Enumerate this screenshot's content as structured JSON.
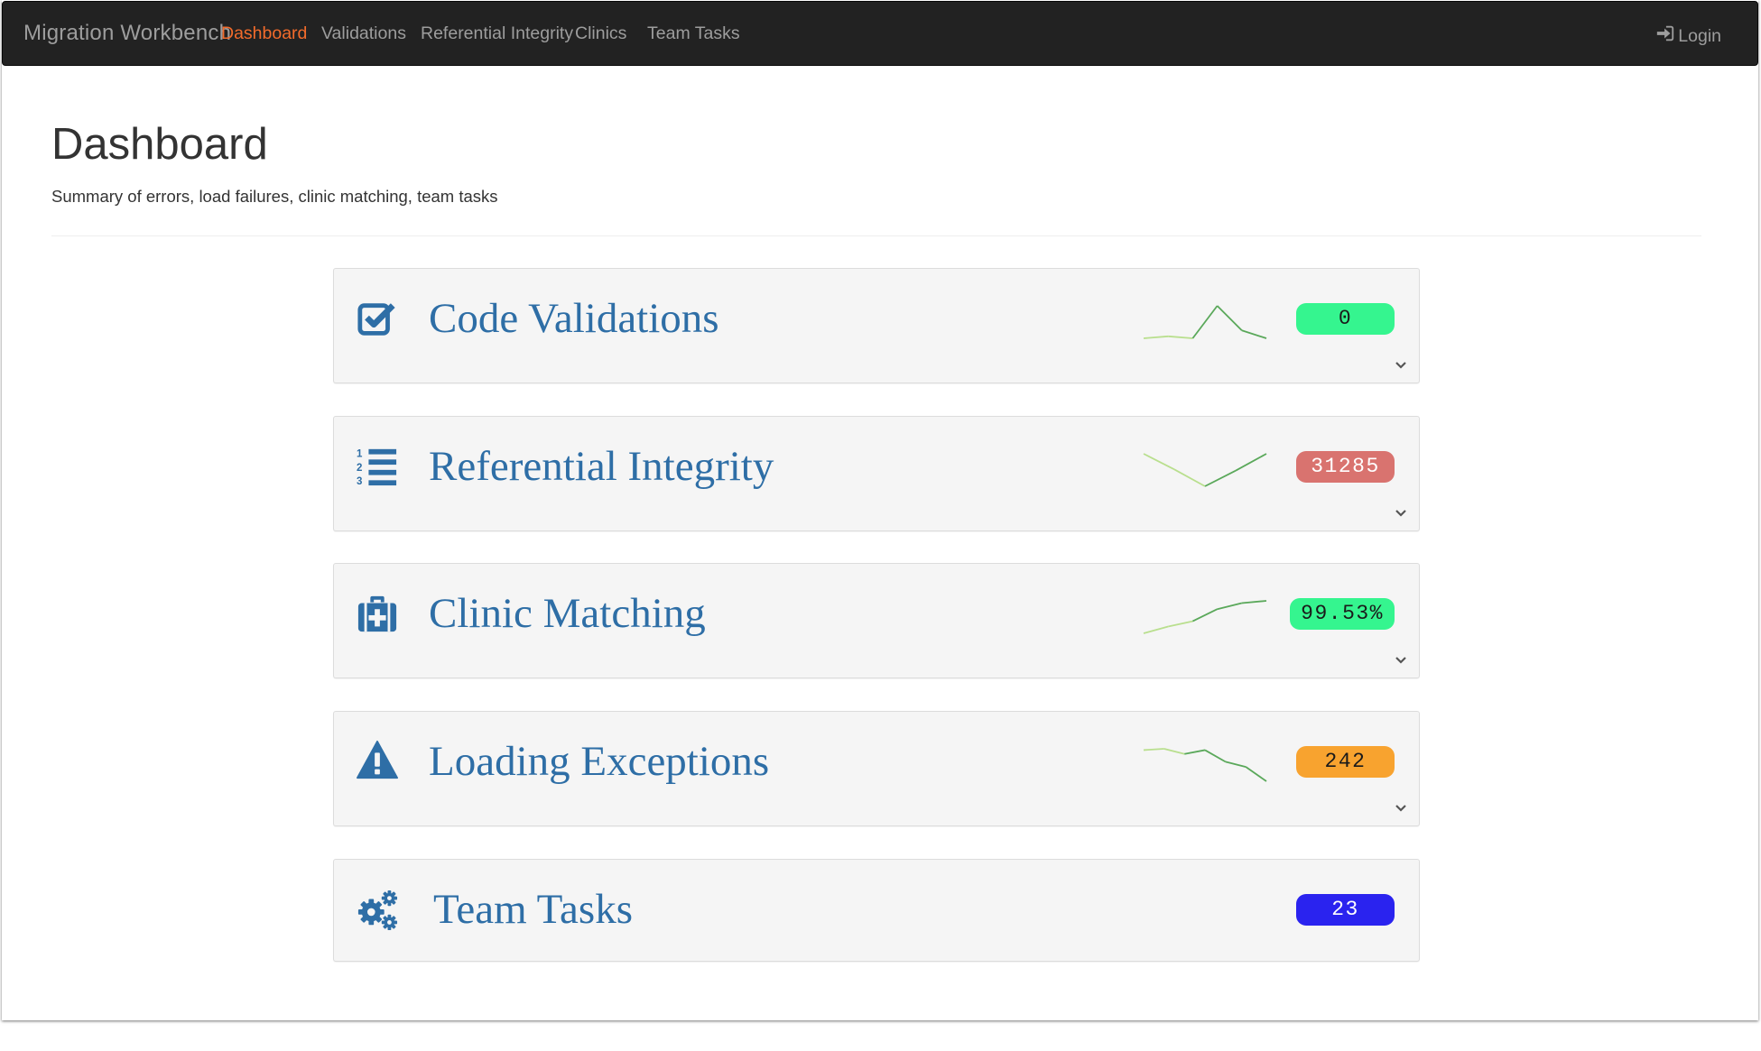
{
  "app": {
    "brand": "Migration Workbench",
    "nav": [
      {
        "label": "Dashboard",
        "active": true
      },
      {
        "label": "Validations",
        "active": false
      },
      {
        "label": "Referential Integrity",
        "active": false
      },
      {
        "label": "Clinics",
        "active": false
      },
      {
        "label": "Team Tasks",
        "active": false
      }
    ],
    "login_label": "Login",
    "login_icon": "sign-in-icon"
  },
  "header": {
    "title": "Dashboard",
    "subtitle": "Summary of errors, load failures, clinic matching, team tasks"
  },
  "colors": {
    "nav_active": "#f26b2b",
    "title_blue": "#2e6ea6",
    "sparkline_light": "#b9df8e",
    "sparkline_dark": "#5aa85a"
  },
  "cards": [
    {
      "title": "Code Validations",
      "icon": "checkbox-checked-icon",
      "badge": "0",
      "badge_bg": "#35f58f",
      "badge_fg": "#1a1a1a",
      "sparkline": [
        0,
        0.2,
        0,
        3.3,
        0.8,
        0
      ],
      "expandable": true
    },
    {
      "title": "Referential Integrity",
      "icon": "numbered-list-icon",
      "badge": "31285",
      "badge_bg": "#d9736f",
      "badge_fg": "#ffffff",
      "sparkline": [
        2.9,
        1.6,
        0.2,
        1.5,
        2.9
      ],
      "expandable": true
    },
    {
      "title": "Clinic Matching",
      "icon": "medkit-icon",
      "badge": "99.53%",
      "badge_bg": "#35f58f",
      "badge_fg": "#1a1a1a",
      "sparkline": [
        99.1,
        99.19,
        99.26,
        99.42,
        99.5,
        99.53
      ],
      "expandable": true
    },
    {
      "title": "Loading Exceptions",
      "icon": "warning-triangle-icon",
      "badge": "242",
      "badge_bg": "#f8a32f",
      "badge_fg": "#1a1a1a",
      "sparkline": [
        3.2,
        3.3,
        2.9,
        3.2,
        2.3,
        1.9,
        0.8
      ],
      "expandable": true
    },
    {
      "title": "Team Tasks",
      "icon": "cogs-icon",
      "badge": "23",
      "badge_bg": "#2a23ef",
      "badge_fg": "#ffffff",
      "sparkline": [],
      "expandable": false
    }
  ]
}
